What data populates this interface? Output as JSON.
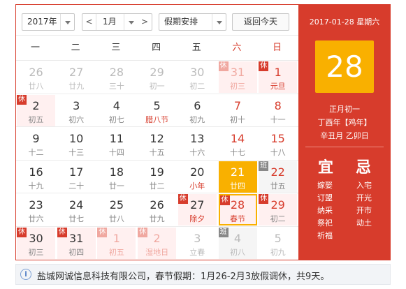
{
  "toolbar": {
    "year": "2017年",
    "month": "1月",
    "prev_arrow": "<",
    "next_arrow": ">",
    "holiday": "假期安排",
    "today_btn": "返回今天"
  },
  "weekdays": [
    "一",
    "二",
    "三",
    "四",
    "五",
    "六",
    "日"
  ],
  "panel": {
    "date_title": "2017-01-28 星期六",
    "big_day": "28",
    "lunar_date": "正月初一",
    "lunar_year": "丁酉年【鸡年】",
    "ganzhi": "辛丑月 乙卯日",
    "yi_label": "宜",
    "ji_label": "忌",
    "yi_items": [
      "嫁娶",
      "订盟",
      "纳采",
      "祭祀",
      "祈福"
    ],
    "ji_items": [
      "入宅",
      "开光",
      "开市",
      "动土"
    ]
  },
  "days": [
    {
      "n": "26",
      "l": "廿八",
      "other": true
    },
    {
      "n": "27",
      "l": "廿九",
      "other": true
    },
    {
      "n": "28",
      "l": "三十",
      "other": true
    },
    {
      "n": "29",
      "l": "初一",
      "other": true
    },
    {
      "n": "30",
      "l": "初二",
      "other": true
    },
    {
      "n": "31",
      "l": "初三",
      "other": true,
      "weekend": true,
      "badge": "休"
    },
    {
      "n": "1",
      "l": "元旦",
      "weekend": true,
      "festival": true,
      "badge": "休"
    },
    {
      "n": "2",
      "l": "初五",
      "badge": "休"
    },
    {
      "n": "3",
      "l": "初六"
    },
    {
      "n": "4",
      "l": "初七"
    },
    {
      "n": "5",
      "l": "腊八节",
      "festival": true
    },
    {
      "n": "6",
      "l": "初九"
    },
    {
      "n": "7",
      "l": "初十",
      "weekend": true
    },
    {
      "n": "8",
      "l": "十一",
      "weekend": true
    },
    {
      "n": "9",
      "l": "十二"
    },
    {
      "n": "10",
      "l": "十三"
    },
    {
      "n": "11",
      "l": "十四"
    },
    {
      "n": "12",
      "l": "十五"
    },
    {
      "n": "13",
      "l": "十六"
    },
    {
      "n": "14",
      "l": "十七",
      "weekend": true
    },
    {
      "n": "15",
      "l": "十八",
      "weekend": true
    },
    {
      "n": "16",
      "l": "十九"
    },
    {
      "n": "17",
      "l": "二十"
    },
    {
      "n": "18",
      "l": "廿一"
    },
    {
      "n": "19",
      "l": "廿二"
    },
    {
      "n": "20",
      "l": "小年",
      "festival": true
    },
    {
      "n": "21",
      "l": "廿四",
      "today": true
    },
    {
      "n": "22",
      "l": "廿五",
      "weekend": true,
      "badge": "班"
    },
    {
      "n": "23",
      "l": "廿六"
    },
    {
      "n": "24",
      "l": "廿七"
    },
    {
      "n": "25",
      "l": "廿八"
    },
    {
      "n": "26",
      "l": "廿九"
    },
    {
      "n": "27",
      "l": "除夕",
      "festival": true,
      "badge": "休"
    },
    {
      "n": "28",
      "l": "春节",
      "festival": true,
      "badge": "休",
      "selected": true
    },
    {
      "n": "29",
      "l": "初二",
      "weekend": true,
      "badge": "休"
    },
    {
      "n": "30",
      "l": "初三",
      "badge": "休"
    },
    {
      "n": "31",
      "l": "初四",
      "badge": "休"
    },
    {
      "n": "1",
      "l": "初五",
      "other": true,
      "badge": "休"
    },
    {
      "n": "2",
      "l": "湿地日",
      "other": true,
      "badge": "休"
    },
    {
      "n": "3",
      "l": "立春",
      "other": true
    },
    {
      "n": "4",
      "l": "初八",
      "other": true,
      "weekend": true,
      "badge": "班"
    },
    {
      "n": "5",
      "l": "初九",
      "other": true,
      "weekend": true
    }
  ],
  "notice": {
    "icon": "info-icon",
    "text": "盐城网诚信息科技有限公司，春节假期：1月26-2月3放假调休，共9天。"
  },
  "colors": {
    "accent_red": "#d73c2c",
    "today_gold": "#f9b000"
  }
}
